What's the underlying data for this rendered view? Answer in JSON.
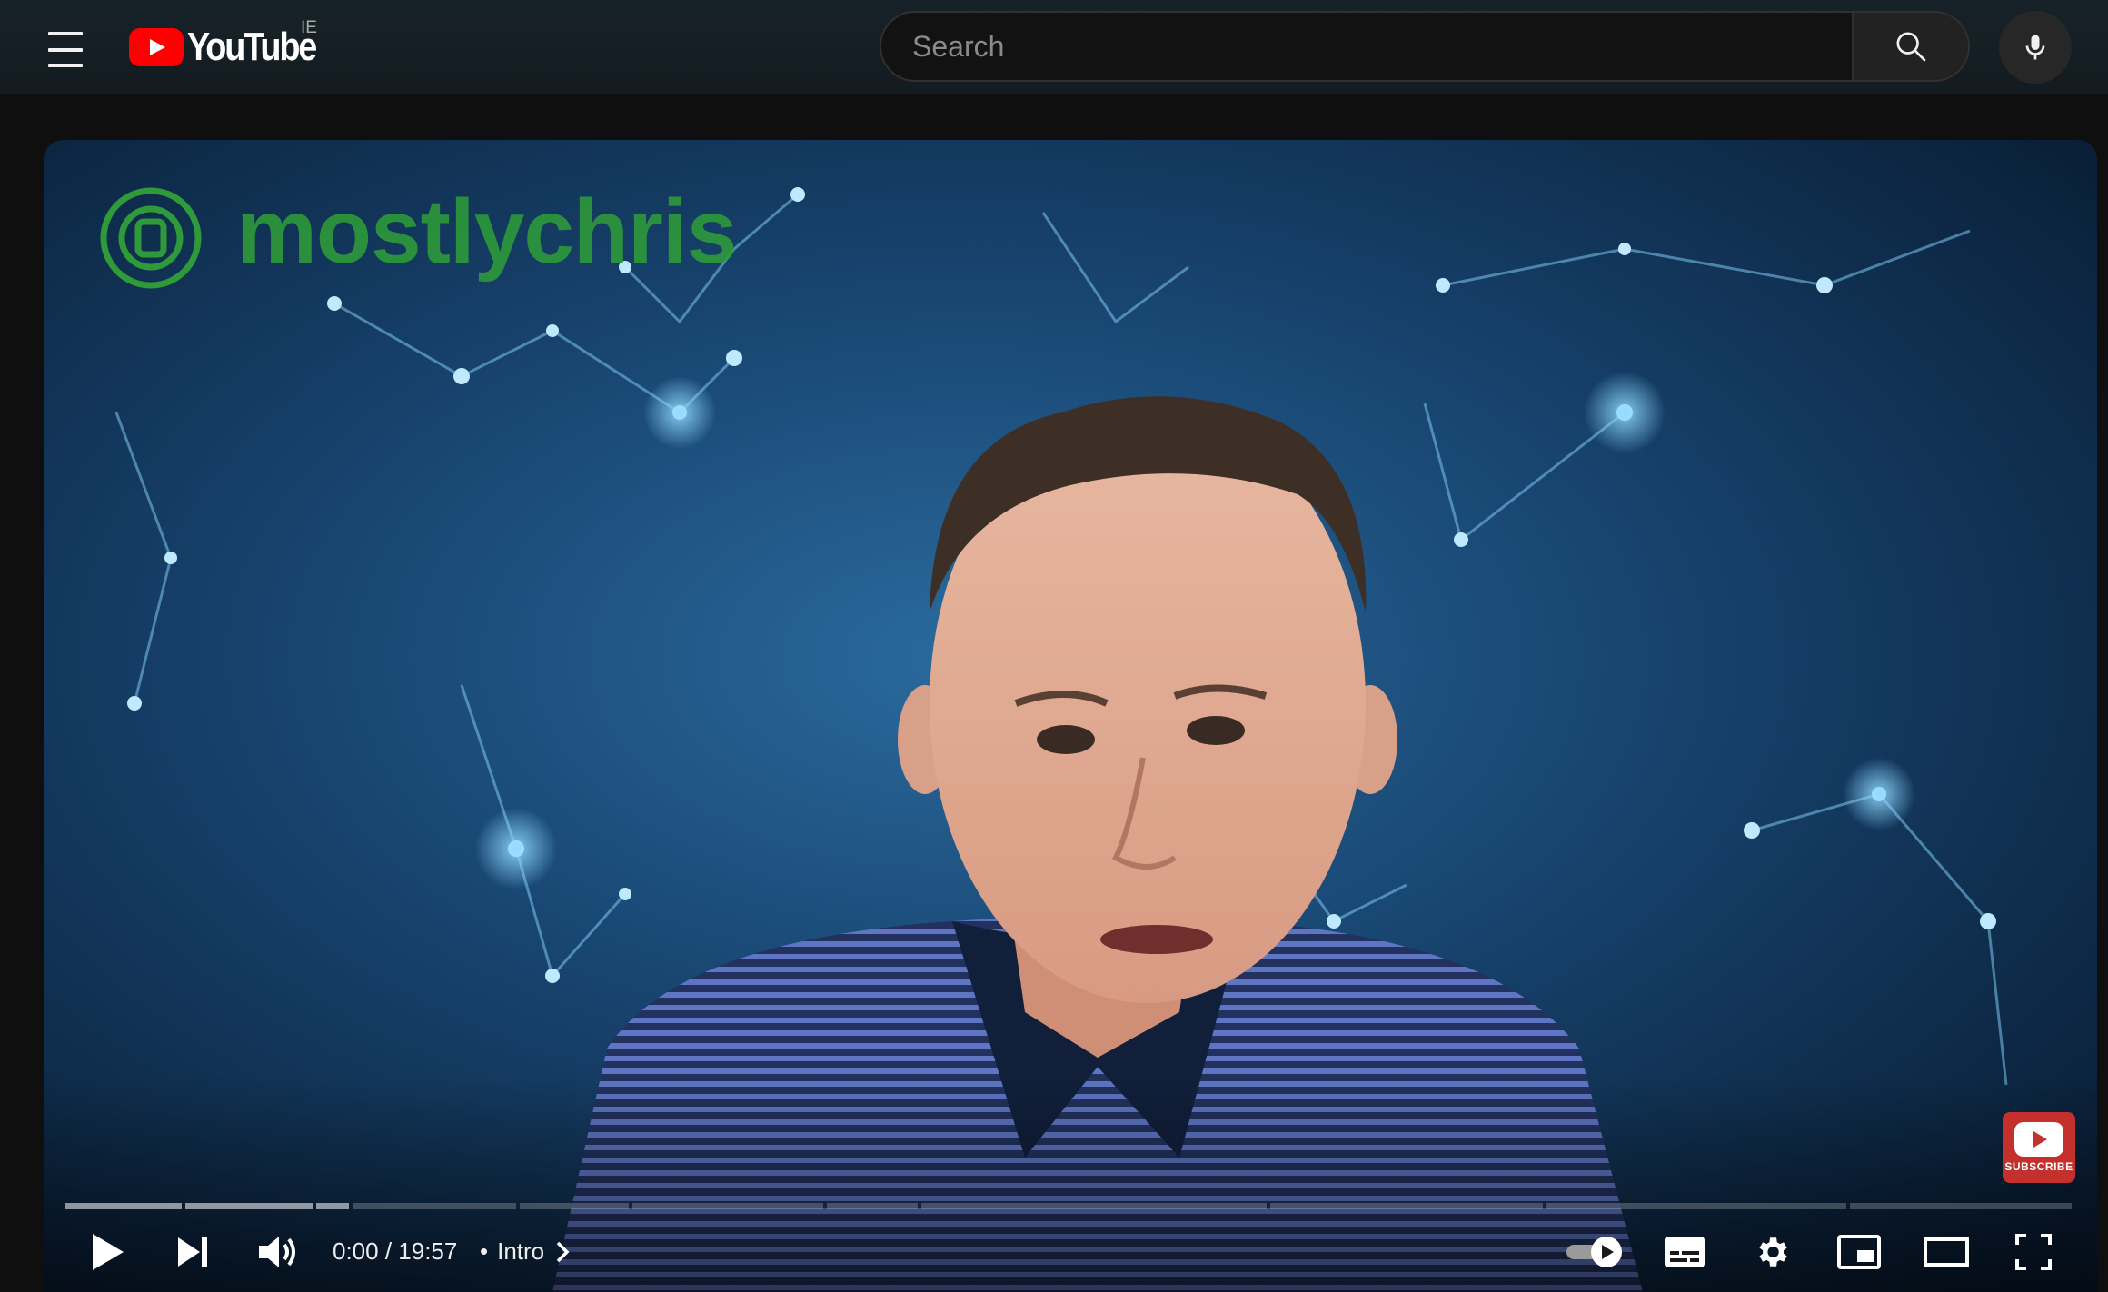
{
  "masthead": {
    "logo_text": "YouTube",
    "country_code": "IE",
    "search": {
      "placeholder": "Search",
      "value": ""
    }
  },
  "video": {
    "watermark_text": "mostlychris",
    "subscribe_label": "SUBSCRIBE"
  },
  "player": {
    "current_time": "0:00",
    "duration": "19:57",
    "time_separator": " / ",
    "chapter_separator": "•",
    "chapter_title": "Intro",
    "progress_fraction": 0.0,
    "autoplay_on": true
  },
  "icons": {
    "menu": "hamburger-menu-icon",
    "search": "search-icon",
    "mic": "microphone-icon",
    "play": "play-icon",
    "next": "next-icon",
    "volume": "volume-icon",
    "chapter": "chevron-right-icon",
    "autoplay": "autoplay-toggle-icon",
    "captions": "captions-icon",
    "settings": "gear-icon",
    "miniplayer": "miniplayer-icon",
    "theater": "theater-mode-icon",
    "fullscreen": "fullscreen-icon"
  },
  "colors": {
    "brand_red": "#ff0000",
    "background": "#0f0f0f",
    "watermark_green": "#2e9a3a"
  }
}
